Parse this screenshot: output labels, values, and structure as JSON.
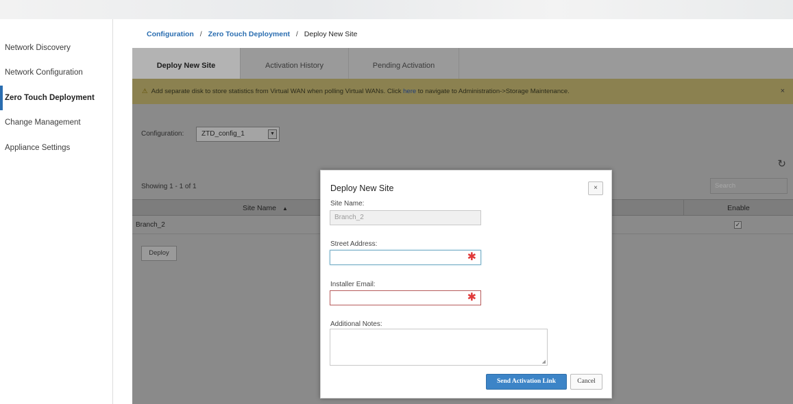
{
  "sidebar": {
    "items": [
      {
        "label": "Network Discovery",
        "active": false
      },
      {
        "label": "Network Configuration",
        "active": false
      },
      {
        "label": "Zero Touch Deployment",
        "active": true
      },
      {
        "label": "Change Management",
        "active": false
      },
      {
        "label": "Appliance Settings",
        "active": false
      }
    ]
  },
  "breadcrumb": {
    "items": [
      "Configuration",
      "Zero Touch Deployment",
      "Deploy New Site"
    ],
    "separator": "/"
  },
  "tabs": [
    {
      "label": "Deploy New Site",
      "active": true
    },
    {
      "label": "Activation History",
      "active": false
    },
    {
      "label": "Pending Activation",
      "active": false
    }
  ],
  "alert": {
    "icon": "warning-icon",
    "text_before": "Add separate disk to store statistics from Virtual WAN when polling Virtual WANs. Click ",
    "link_text": "here",
    "text_after": " to navigate to Administration->Storage Maintenance.",
    "close": "×",
    "color": "#f5e27a"
  },
  "config": {
    "label": "Configuration:",
    "selected": "ZTD_config_1"
  },
  "table": {
    "showing": "Showing 1 - 1 of 1",
    "search_placeholder": "Search",
    "columns": [
      "Site Name",
      "Enable"
    ],
    "sort_indicator": "▲",
    "rows": [
      {
        "site_name": "Branch_2",
        "enable": true
      }
    ],
    "deploy_label": "Deploy"
  },
  "modal": {
    "title": "Deploy New Site",
    "close": "×",
    "site_name_label": "Site Name:",
    "site_name_value": "Branch_2",
    "street_label": "Street Address:",
    "email_label": "Installer Email:",
    "notes_label": "Additional Notes:",
    "required_mark": "✱",
    "send_label": "Send Activation Link",
    "cancel_label": "Cancel"
  },
  "colors": {
    "accent": "#2a6db0",
    "primary_button": "#3c84c7",
    "required": "#e03a3a"
  }
}
